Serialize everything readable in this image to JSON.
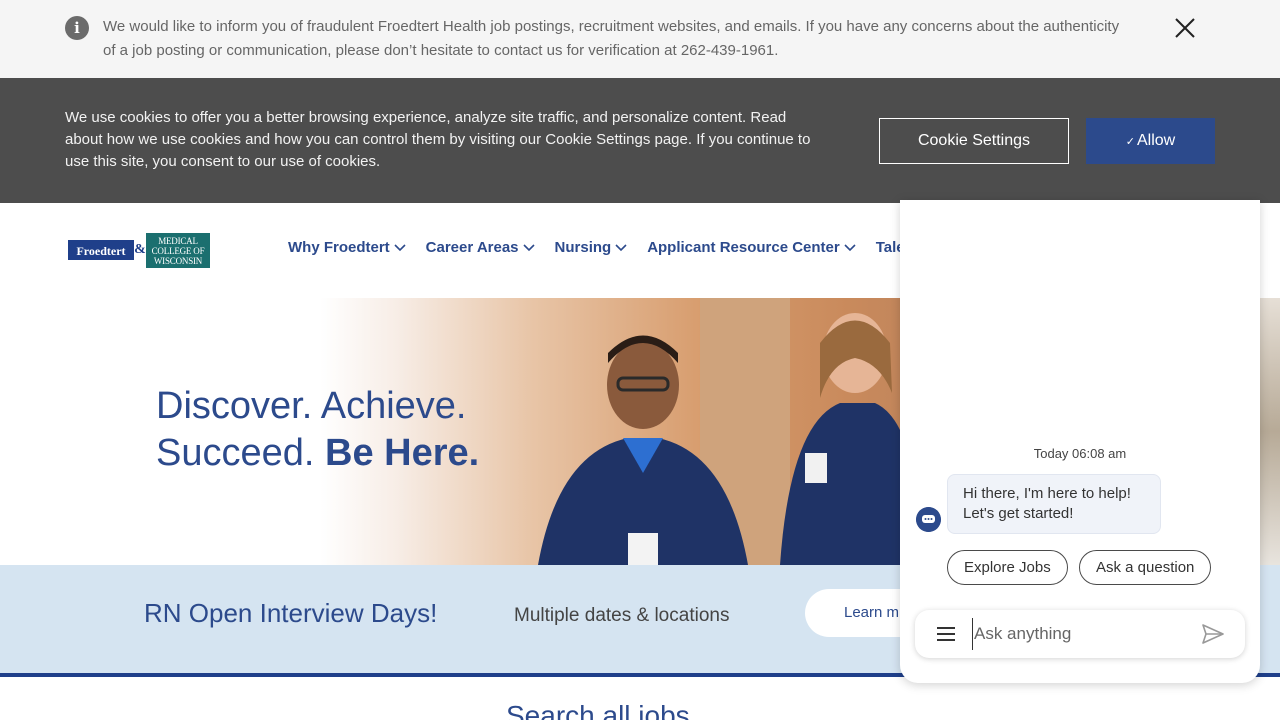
{
  "alert": {
    "text": "We would like to inform you of fraudulent Froedtert Health job postings, recruitment websites, and emails. If you have any concerns about the authenticity of a job posting or communication, please don’t hesitate to contact us for verification at 262-439-1961."
  },
  "cookie": {
    "text": "We use cookies to offer you a better browsing experience, analyze site traffic, and personalize content. Read about how we use cookies and how you can control them by visiting our Cookie Settings page. If you continue to use this site, you consent to our use of cookies.",
    "settings_label": "Cookie Settings",
    "allow_label": "Allow"
  },
  "logo": {
    "left": "Froedtert",
    "amp": "&",
    "right": "Medical College of Wisconsin"
  },
  "nav": {
    "items": [
      {
        "label": "Why Froedtert"
      },
      {
        "label": "Career Areas"
      },
      {
        "label": "Nursing"
      },
      {
        "label": "Applicant Resource Center"
      },
      {
        "label": "Talent C"
      }
    ]
  },
  "hero": {
    "line1": "Discover. Achieve.",
    "line2_regular": "Succeed.",
    "line2_bold": "Be Here."
  },
  "promo": {
    "title": "RN Open Interview Days!",
    "subtitle": "Multiple dates & locations",
    "button": "Learn m"
  },
  "search": {
    "title": "Search all jobs"
  },
  "chat": {
    "timestamp": "Today 06:08 am",
    "greeting": "Hi there, I'm here to help! Let's get started!",
    "chips": [
      "Explore Jobs",
      "Ask a question"
    ],
    "input_placeholder": "Ask anything"
  },
  "colors": {
    "brand_blue": "#2c4a8c",
    "cookie_bg": "#4d4d4d",
    "promo_bg": "#d5e4f1"
  }
}
